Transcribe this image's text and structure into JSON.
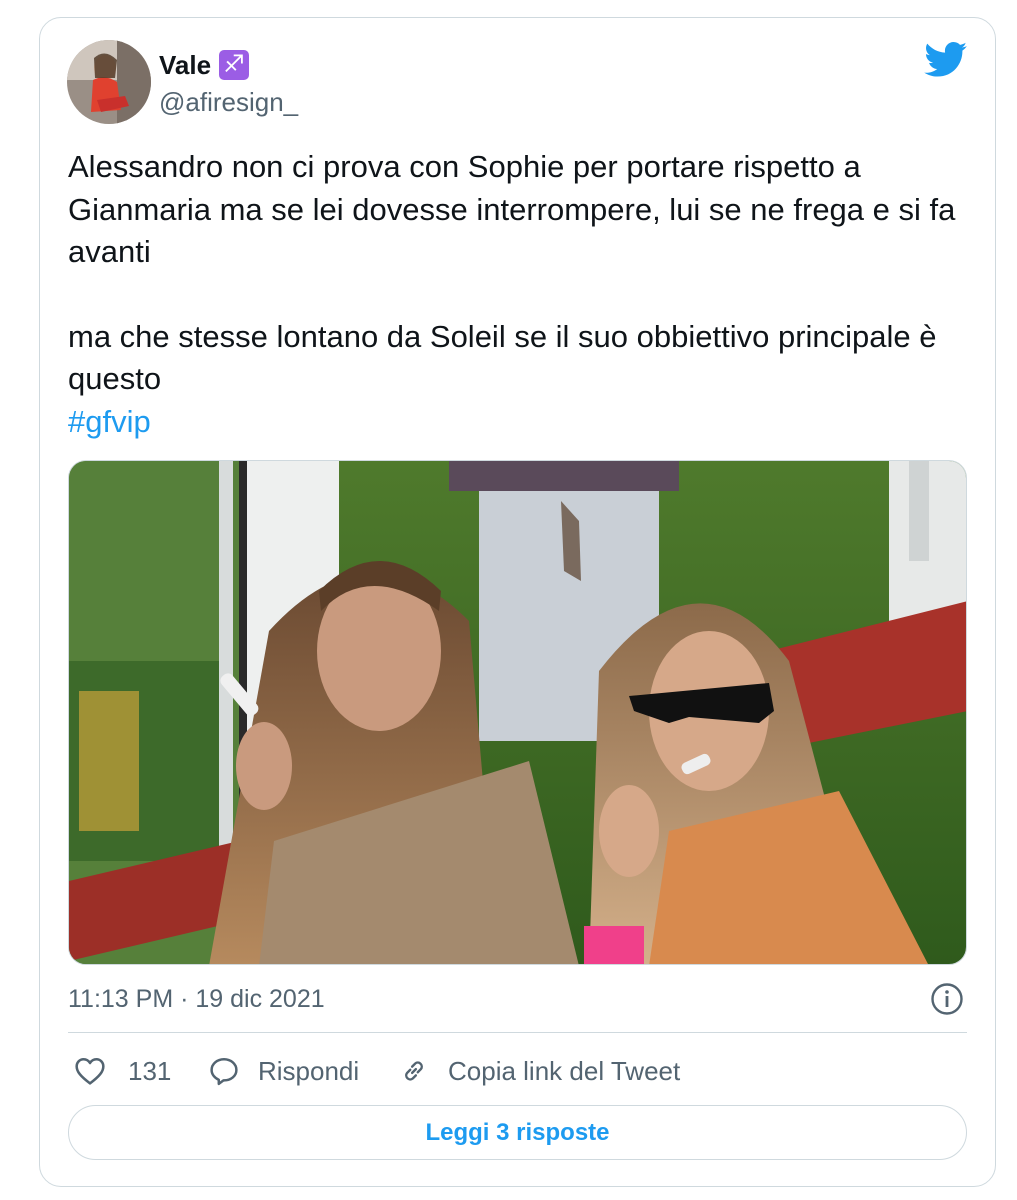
{
  "tweet": {
    "author": {
      "name": "Vale",
      "zodiac_badge": "♐",
      "handle": "@afiresign_",
      "avatar_icon": "profile-photo"
    },
    "text_paragraph_1": "Alessandro non ci prova con Sophie per portare rispetto a Gianmaria ma se lei dovesse interrompere, lui se ne frega e si fa avanti",
    "text_paragraph_2": "ma che stesse lontano da Soleil se il suo obbiettivo principale è questo",
    "hashtag": "#gfvip",
    "timestamp": "11:13 PM · 19 dic 2021",
    "actions": {
      "likes_count": "131",
      "reply_label": "Rispondi",
      "copy_link_label": "Copia link del Tweet"
    },
    "read_replies_label": "Leggi 3 risposte"
  },
  "colors": {
    "accent": "#1d9bf0",
    "secondary_text": "#536471",
    "border": "#cfd9de",
    "zodiac_badge_bg": "#9b5de5"
  },
  "icons": {
    "brand": "twitter-bird-icon",
    "info": "info-icon",
    "like": "heart-icon",
    "reply": "speech-bubble-icon",
    "copy_link": "link-icon"
  }
}
